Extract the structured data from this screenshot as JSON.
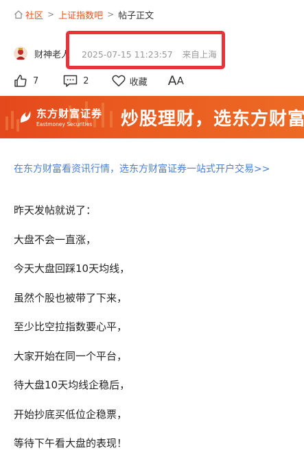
{
  "breadcrumb": {
    "items": [
      "社区",
      "上证指数吧"
    ],
    "current": "帖子正文",
    "separator": ">"
  },
  "post": {
    "author": "财神老人",
    "timestamp": "2025-07-15 11:23:57",
    "location": "来自上海",
    "likes": "7",
    "comments": "2",
    "favorite_label": "收藏",
    "font_size_label_big": "A",
    "font_size_label_small": "A"
  },
  "banner": {
    "brand": "东方财富证券",
    "brand_en": "Eastmoney Securities",
    "slogan": "炒股理财，选东方财富证券"
  },
  "promo_link": "在东方财富看资讯行情，选东方财富证券一站式开户交易>>",
  "content": {
    "lines": [
      "昨天发帖就说了：",
      "大盘不会一直涨，",
      "今天大盘回踩10天均线，",
      "虽然个股也被带了下来，",
      "至少比空拉指数要心平，",
      "大家开始在同一个平台，",
      "待大盘10天均线企稳后，",
      "开始抄底买低位企稳票，",
      "等待下午看大盘的表现！"
    ]
  },
  "colors": {
    "accent": "#e8541e",
    "highlight_box": "#e8333a",
    "link": "#4a7fd6",
    "meta": "#999999"
  }
}
